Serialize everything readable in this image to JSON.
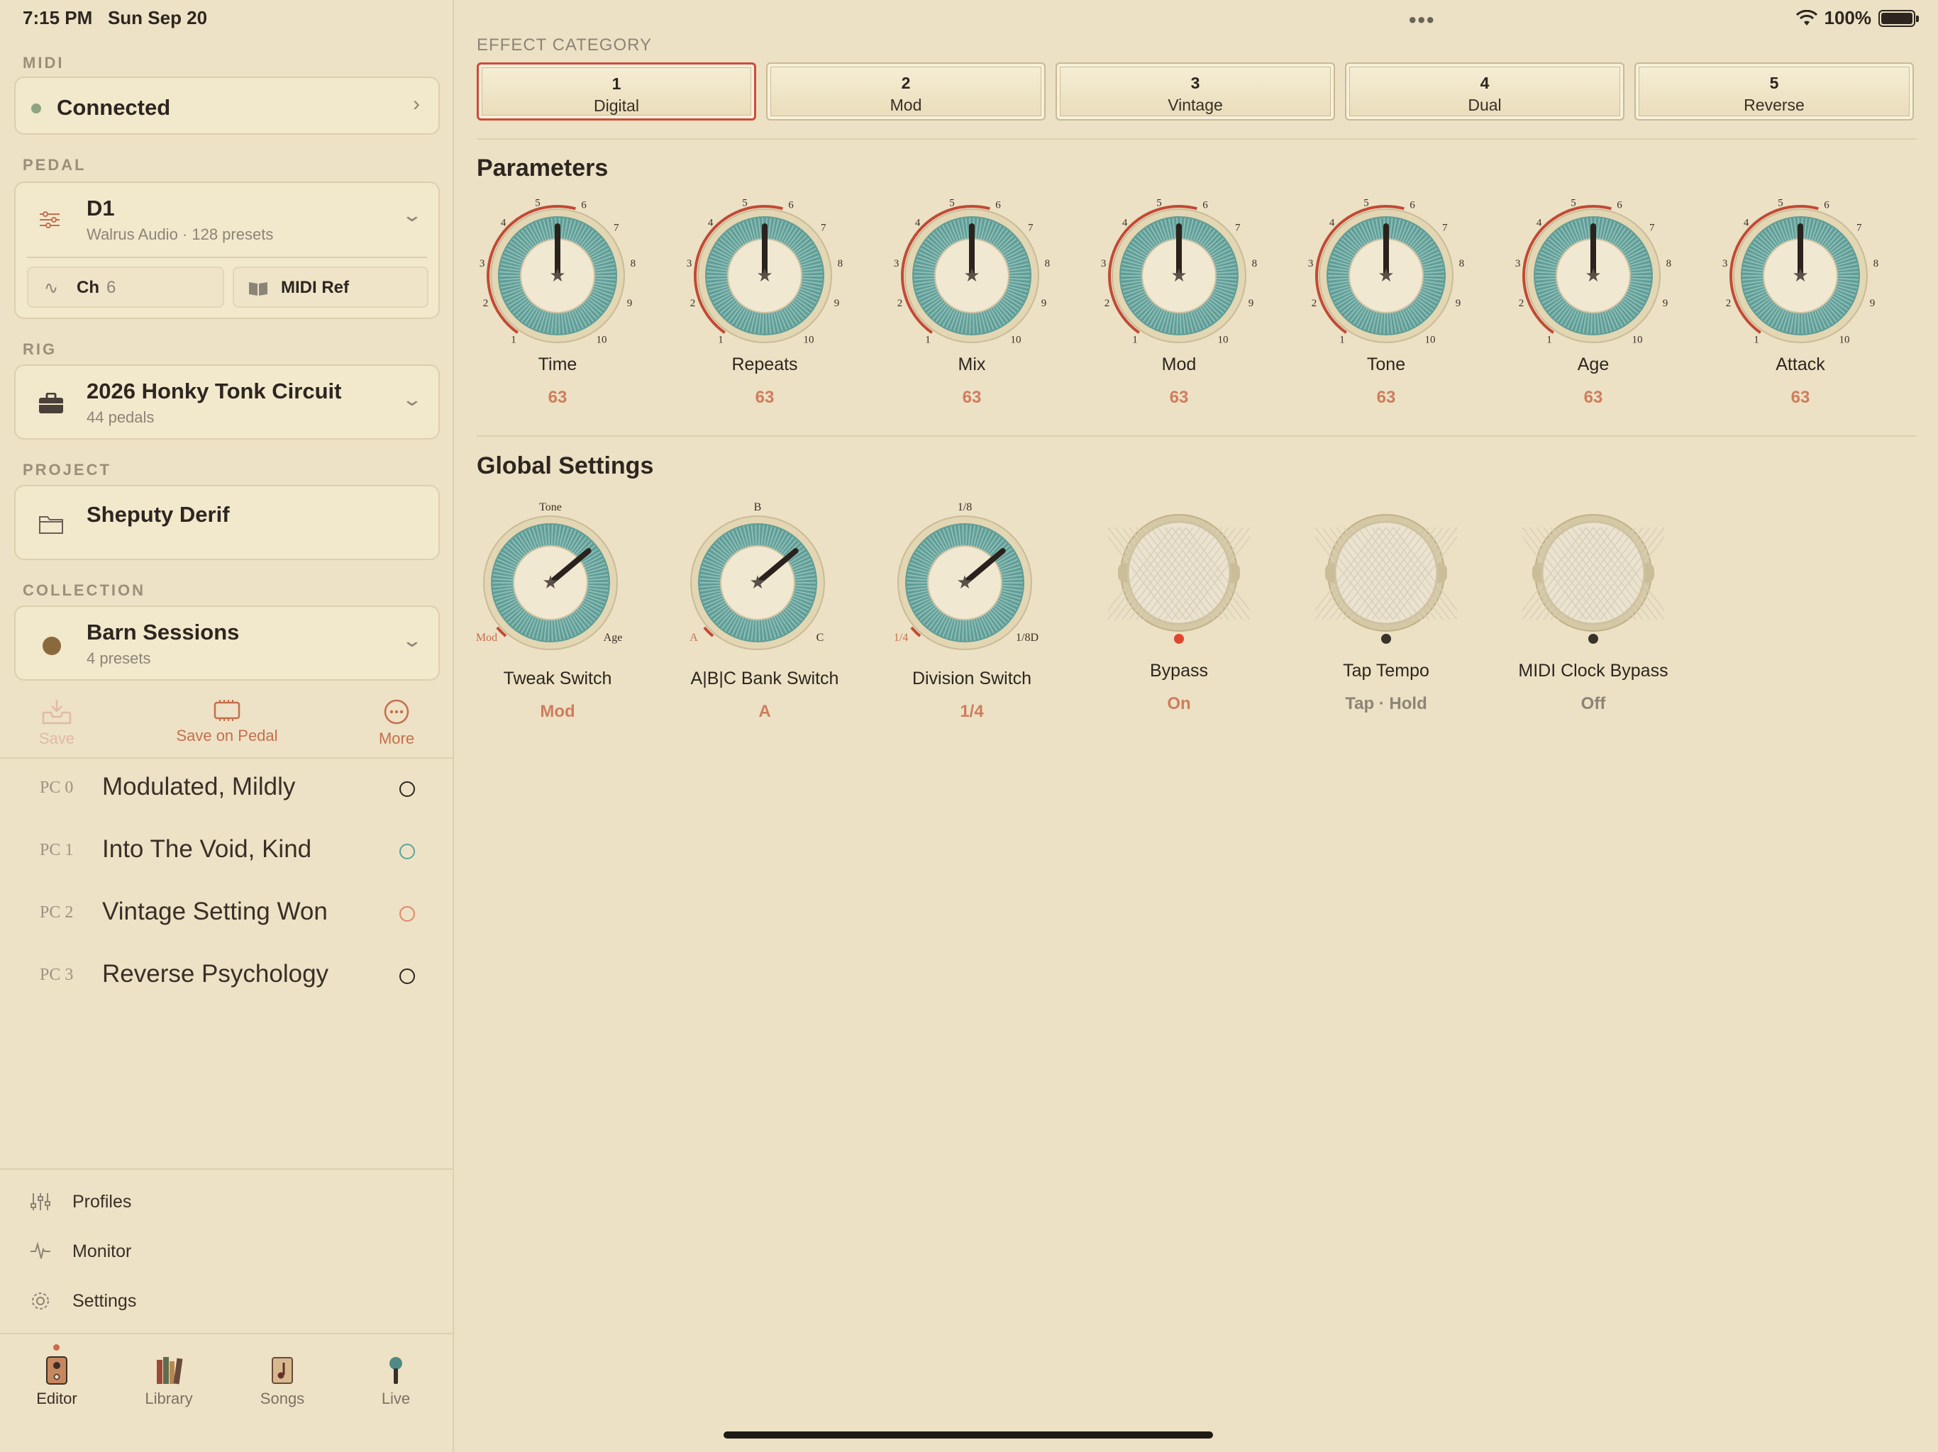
{
  "status": {
    "time": "7:15 PM",
    "date": "Sun Sep 20",
    "battery": "100%"
  },
  "midi": {
    "label": "MIDI",
    "status": "Connected",
    "status_color": "#8da383"
  },
  "pedal": {
    "label": "PEDAL",
    "name": "D1",
    "sub": "Walrus Audio · 128 presets",
    "ch_label": "Ch",
    "ch_value": "6",
    "midi_ref": "MIDI Ref"
  },
  "rig": {
    "label": "RIG",
    "name": "2026 Honky Tonk Circuit",
    "sub": "44 pedals"
  },
  "project": {
    "label": "PROJECT",
    "name": "Sheputy Derif"
  },
  "collection": {
    "label": "COLLECTION",
    "name": "Barn Sessions",
    "sub": "4 presets",
    "dot_color": "#8a6a3c"
  },
  "actions": {
    "save": "Save",
    "save_pedal": "Save on Pedal",
    "more": "More"
  },
  "presets": [
    {
      "pc": "PC 0",
      "name": "Modulated, Mildly",
      "ring_color": "#2d2620"
    },
    {
      "pc": "PC 1",
      "name": "Into The Void, Kind",
      "ring_color": "#5fa39a"
    },
    {
      "pc": "PC 2",
      "name": "Vintage Setting Won",
      "ring_color": "#e08a6a"
    },
    {
      "pc": "PC 3",
      "name": "Reverse Psychology",
      "ring_color": "#2d2620"
    }
  ],
  "nav": {
    "profiles": "Profiles",
    "monitor": "Monitor",
    "settings": "Settings"
  },
  "tabs": [
    {
      "label": "Editor",
      "icon": "pedal-icon"
    },
    {
      "label": "Library",
      "icon": "books-icon"
    },
    {
      "label": "Songs",
      "icon": "music-note-icon"
    },
    {
      "label": "Live",
      "icon": "microphone-icon"
    }
  ],
  "effect_category": {
    "label": "EFFECT CATEGORY",
    "selected": 0,
    "options": [
      {
        "num": "1",
        "name": "Digital"
      },
      {
        "num": "2",
        "name": "Mod"
      },
      {
        "num": "3",
        "name": "Vintage"
      },
      {
        "num": "4",
        "name": "Dual"
      },
      {
        "num": "5",
        "name": "Reverse"
      }
    ]
  },
  "parameters": {
    "title": "Parameters",
    "ticks": [
      "1",
      "2",
      "3",
      "4",
      "5",
      "6",
      "7",
      "8",
      "9",
      "10"
    ],
    "knobs": [
      {
        "label": "Time",
        "value": "63"
      },
      {
        "label": "Repeats",
        "value": "63"
      },
      {
        "label": "Mix",
        "value": "63"
      },
      {
        "label": "Mod",
        "value": "63"
      },
      {
        "label": "Tone",
        "value": "63"
      },
      {
        "label": "Age",
        "value": "63"
      },
      {
        "label": "Attack",
        "value": "63"
      }
    ]
  },
  "global": {
    "title": "Global Settings",
    "switches": [
      {
        "label": "Tweak Switch",
        "value": "Mod",
        "left": "Mod",
        "top": "Tone",
        "right": "Age"
      },
      {
        "label": "A|B|C Bank Switch",
        "value": "A",
        "left": "A",
        "top": "B",
        "right": "C"
      },
      {
        "label": "Division Switch",
        "value": "1/4",
        "left": "1/4",
        "top": "1/8",
        "right": "1/8D"
      }
    ],
    "buttons": [
      {
        "label": "Bypass",
        "value": "On",
        "led": "#e0452f"
      },
      {
        "label": "Tap Tempo",
        "value": "Tap · Hold",
        "led": "#3a332c"
      },
      {
        "label": "MIDI Clock Bypass",
        "value": "Off",
        "led": "#3a332c"
      }
    ]
  }
}
